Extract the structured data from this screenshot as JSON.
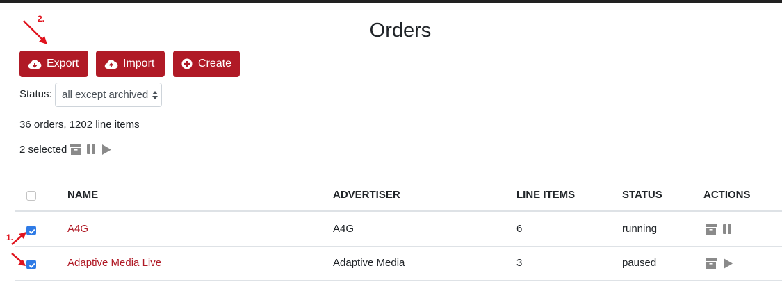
{
  "page": {
    "title": "Orders"
  },
  "toolbar": {
    "export_label": "Export",
    "import_label": "Import",
    "create_label": "Create"
  },
  "filter": {
    "status_label": "Status:",
    "status_value": "all except archived"
  },
  "summary": "36 orders, 1202 line items",
  "selection": {
    "text": "2 selected"
  },
  "table": {
    "headers": [
      "NAME",
      "ADVERTISER",
      "LINE ITEMS",
      "STATUS",
      "ACTIONS"
    ],
    "rows": [
      {
        "name": "A4G",
        "advertiser": "A4G",
        "line_items": "6",
        "status": "running",
        "checked": true
      },
      {
        "name": "Adaptive Media Live",
        "advertiser": "Adaptive Media",
        "line_items": "3",
        "status": "paused",
        "checked": true
      }
    ]
  },
  "annotations": {
    "step1": "1.",
    "step2": "2."
  },
  "colors": {
    "brand": "#b01a26",
    "checkbox": "#2f7be6",
    "annotation": "#e0141e",
    "icon_gray": "#8a8a8a"
  }
}
